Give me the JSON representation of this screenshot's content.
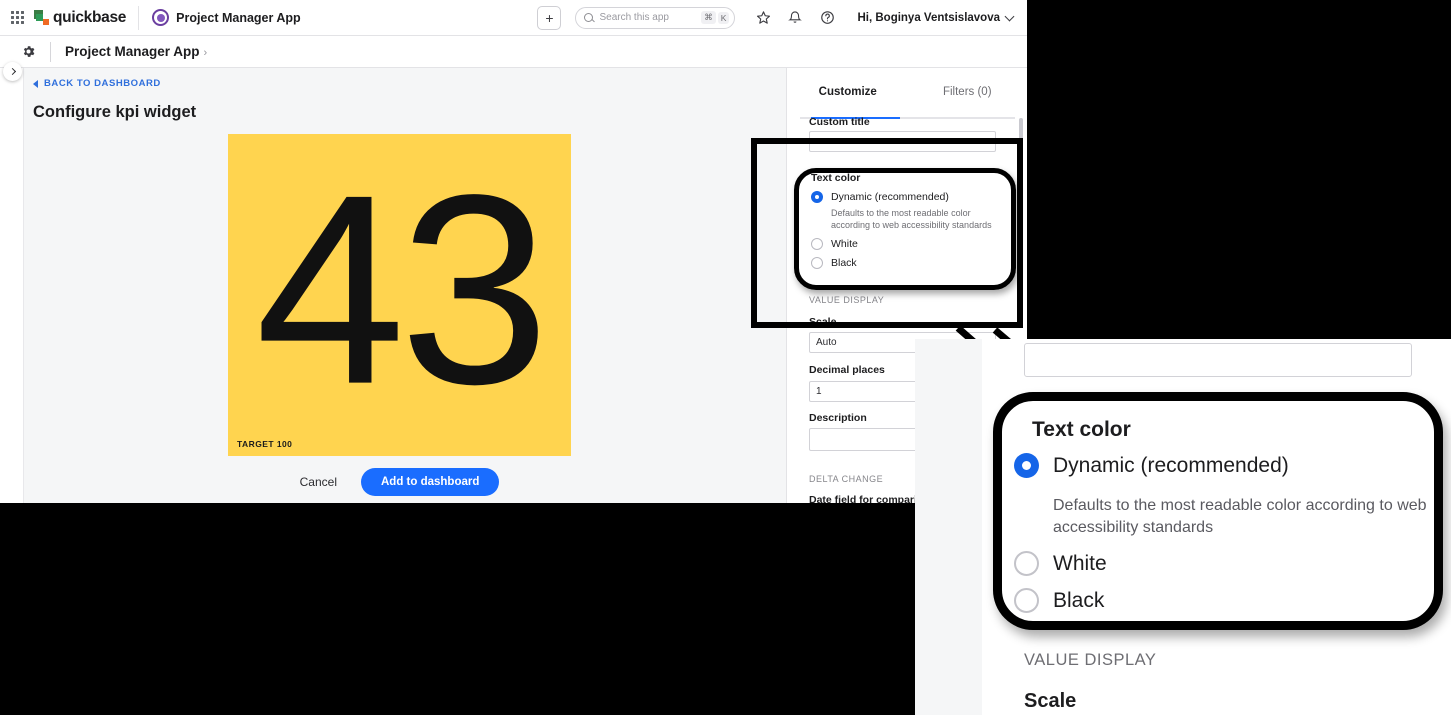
{
  "header": {
    "waffle_icon": "apps-grid-icon",
    "brand": "quickbase",
    "app_name": "Project Manager App",
    "add_label": "+",
    "search": {
      "placeholder": "Search this app",
      "shortcut_modifier": "⌘",
      "shortcut_key": "K",
      "icon": "search-icon"
    },
    "icons": [
      "star-icon",
      "bell-icon",
      "help-icon"
    ],
    "user_greeting": "Hi, Boginya Ventsislavova"
  },
  "appbar": {
    "gear_icon": "gear-icon",
    "breadcrumb": "Project Manager App",
    "breadcrumb_chevron": "›"
  },
  "rail": {
    "expand_icon": "chevron-right-icon"
  },
  "main": {
    "back_link": "BACK TO DASHBOARD",
    "page_title": "Configure kpi widget",
    "kpi": {
      "value": "43",
      "target_label": "TARGET 100",
      "background_color": "#ffd44f",
      "text_color": "#111111"
    },
    "cancel_label": "Cancel",
    "primary_label": "Add to dashboard",
    "primary_color": "#1a6dff"
  },
  "panel": {
    "tabs": [
      {
        "label": "Customize",
        "active": true
      },
      {
        "label": "Filters (0)",
        "active": false
      }
    ],
    "custom_title": {
      "label": "Custom title",
      "value": ""
    },
    "text_color": {
      "title": "Text color",
      "options": [
        {
          "label": "Dynamic (recommended)",
          "selected": true,
          "help": "Defaults to the most readable color according to web accessibility standards"
        },
        {
          "label": "White",
          "selected": false
        },
        {
          "label": "Black",
          "selected": false
        }
      ]
    },
    "value_display_header": "VALUE DISPLAY",
    "scale": {
      "label": "Scale",
      "value": "Auto"
    },
    "decimal_places": {
      "label": "Decimal places",
      "value": "1"
    },
    "description": {
      "label": "Description",
      "value": ""
    },
    "delta_change_header": "DELTA CHANGE",
    "date_field": {
      "label": "Date field for comparison"
    }
  },
  "callout": {
    "title": "Text color",
    "options": [
      {
        "label": "Dynamic (recommended)",
        "selected": true
      },
      {
        "label": "White",
        "selected": false
      },
      {
        "label": "Black",
        "selected": false
      }
    ],
    "help": "Defaults to the most readable color according to web accessibility standards",
    "value_display_header": "VALUE DISPLAY",
    "scale_label": "Scale",
    "accent_color": "#1565e8"
  }
}
